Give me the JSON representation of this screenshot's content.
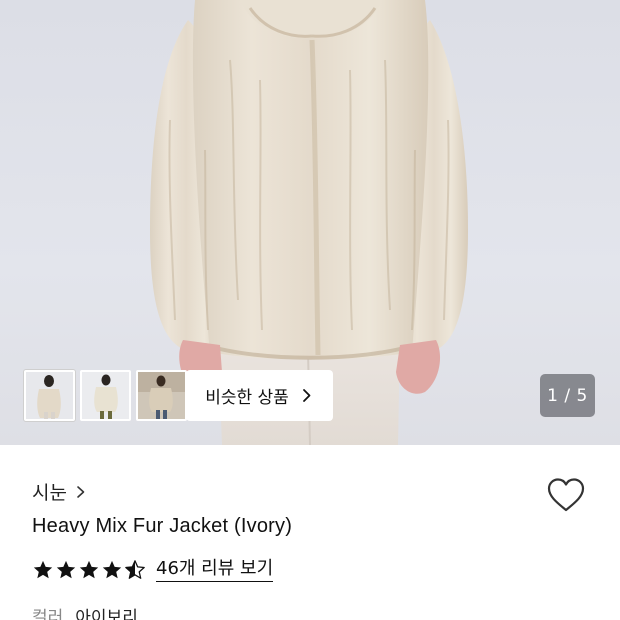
{
  "gallery": {
    "similar_label": "비슷한 상품",
    "counter": "1 / 5",
    "thumbnails": [
      "thumb-model-front",
      "thumb-product-flat",
      "thumb-model-styled"
    ],
    "active_thumbnail": 0
  },
  "product": {
    "brand": "시눈",
    "name": "Heavy Mix Fur Jacket (Ivory)",
    "rating": 4.5,
    "reviews_label": "46개 리뷰 보기",
    "color_label": "컬러",
    "color_value": "아이보리"
  },
  "icons": {
    "similar_chevron": "chevron-right-icon",
    "brand_chevron": "chevron-right-icon",
    "wishlist": "heart-outline-icon",
    "rating": "star-icon"
  },
  "colors": {
    "fur": "#e6dccd",
    "fur_shadow": "#bfae94",
    "glove": "#e0a9a5",
    "counter_bg": "#6e7076"
  }
}
